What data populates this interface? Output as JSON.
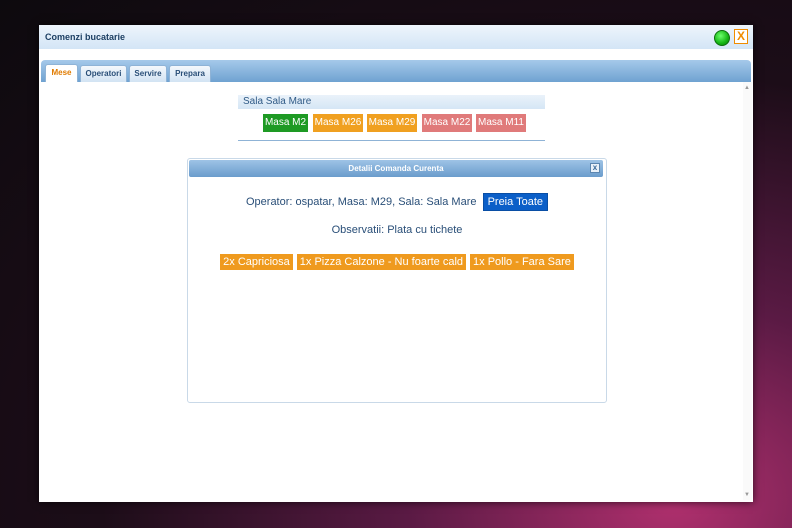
{
  "window": {
    "title": "Comenzi bucatarie",
    "close_label": "X"
  },
  "tabs": [
    {
      "label": "Mese"
    },
    {
      "label": "Operatori"
    },
    {
      "label": "Servire"
    },
    {
      "label": "Prepara"
    }
  ],
  "room": {
    "header": "Sala Sala Mare",
    "tables": [
      {
        "label": "Masa M2",
        "color": "#1e9a24"
      },
      {
        "label": "Masa M26",
        "color": "#f0a020"
      },
      {
        "label": "Masa M29",
        "color": "#f0a020"
      },
      {
        "label": "Masa M22",
        "color": "#e07a7a"
      },
      {
        "label": "Masa M11",
        "color": "#e07a7a"
      }
    ]
  },
  "dialog": {
    "title": "Detalii Comanda Curenta",
    "close_label": "x",
    "operator_line": "Operator: ospatar, Masa: M29, Sala: Sala Mare",
    "preia_label": "Preia Toate",
    "observatii": "Observatii: Plata cu tichete",
    "items": [
      {
        "label": "2x Capriciosa"
      },
      {
        "label": "1x Pizza Calzone - Nu foarte cald"
      },
      {
        "label": "1x Pollo - Fara Sare"
      }
    ]
  },
  "colors": {
    "accent": "#e07b00",
    "status_online": "#15b515",
    "preia_button": "#0b5fc8",
    "item_pending": "#ef9a1e"
  },
  "icons": {
    "status": "status-online-icon",
    "scroll_up": "arrow-up-icon",
    "scroll_down": "arrow-down-icon"
  }
}
